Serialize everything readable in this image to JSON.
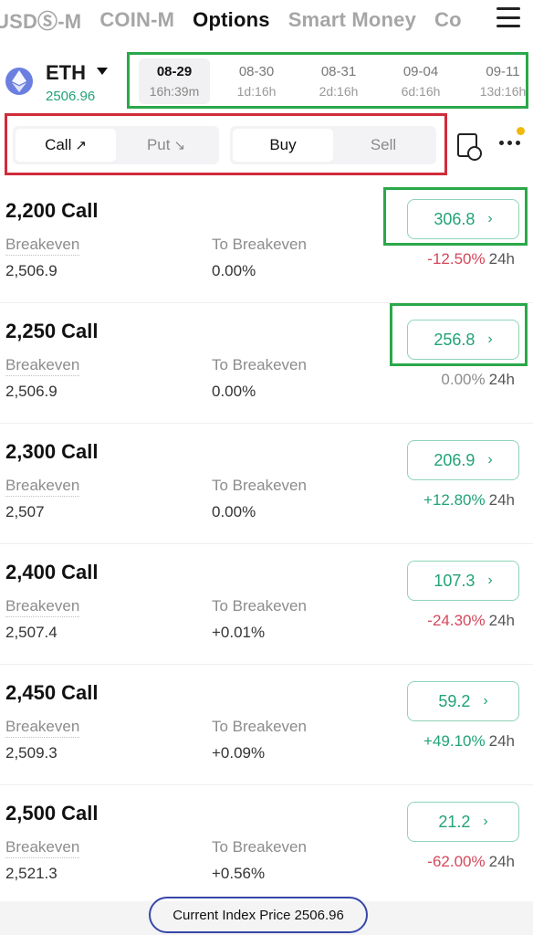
{
  "topnav": {
    "tabs": [
      "USDⓈ-M",
      "COIN-M",
      "Options",
      "Smart Money",
      "Co"
    ],
    "active": "Options"
  },
  "asset": {
    "symbol": "ETH",
    "price": "2506.96",
    "icon": "ethereum-icon"
  },
  "expiries": [
    {
      "date": "08-29",
      "remaining": "16h:39m",
      "active": true
    },
    {
      "date": "08-30",
      "remaining": "1d:16h"
    },
    {
      "date": "08-31",
      "remaining": "2d:16h"
    },
    {
      "date": "09-04",
      "remaining": "6d:16h"
    },
    {
      "date": "09-11",
      "remaining": "13d:16h"
    }
  ],
  "controls": {
    "call": "Call",
    "call_arrow": "↗",
    "put": "Put",
    "put_arrow": "↘",
    "buy": "Buy",
    "sell": "Sell",
    "active_type": "call",
    "active_side": "buy"
  },
  "labels": {
    "breakeven": "Breakeven",
    "to_breakeven": "To Breakeven",
    "period": "24h"
  },
  "options": [
    {
      "strike": "2,200 Call",
      "breakeven": "2,506.9",
      "to_breakeven": "0.00%",
      "price": "306.8",
      "change": "-12.50%",
      "dir": "neg"
    },
    {
      "strike": "2,250 Call",
      "breakeven": "2,506.9",
      "to_breakeven": "0.00%",
      "price": "256.8",
      "change": "0.00%",
      "dir": "zero"
    },
    {
      "strike": "2,300 Call",
      "breakeven": "2,507",
      "to_breakeven": "0.00%",
      "price": "206.9",
      "change": "+12.80%",
      "dir": "pos"
    },
    {
      "strike": "2,400 Call",
      "breakeven": "2,507.4",
      "to_breakeven": "+0.01%",
      "price": "107.3",
      "change": "-24.30%",
      "dir": "neg"
    },
    {
      "strike": "2,450 Call",
      "breakeven": "2,509.3",
      "to_breakeven": "+0.09%",
      "price": "59.2",
      "change": "+49.10%",
      "dir": "pos"
    },
    {
      "strike": "2,500 Call",
      "breakeven": "2,521.3",
      "to_breakeven": "+0.56%",
      "price": "21.2",
      "change": "-62.00%",
      "dir": "neg"
    }
  ],
  "footer": {
    "index_price": "Current Index Price 2506.96"
  },
  "colors": {
    "up": "#21a377",
    "down": "#d4475b",
    "brand_yellow": "#f0b90b"
  }
}
